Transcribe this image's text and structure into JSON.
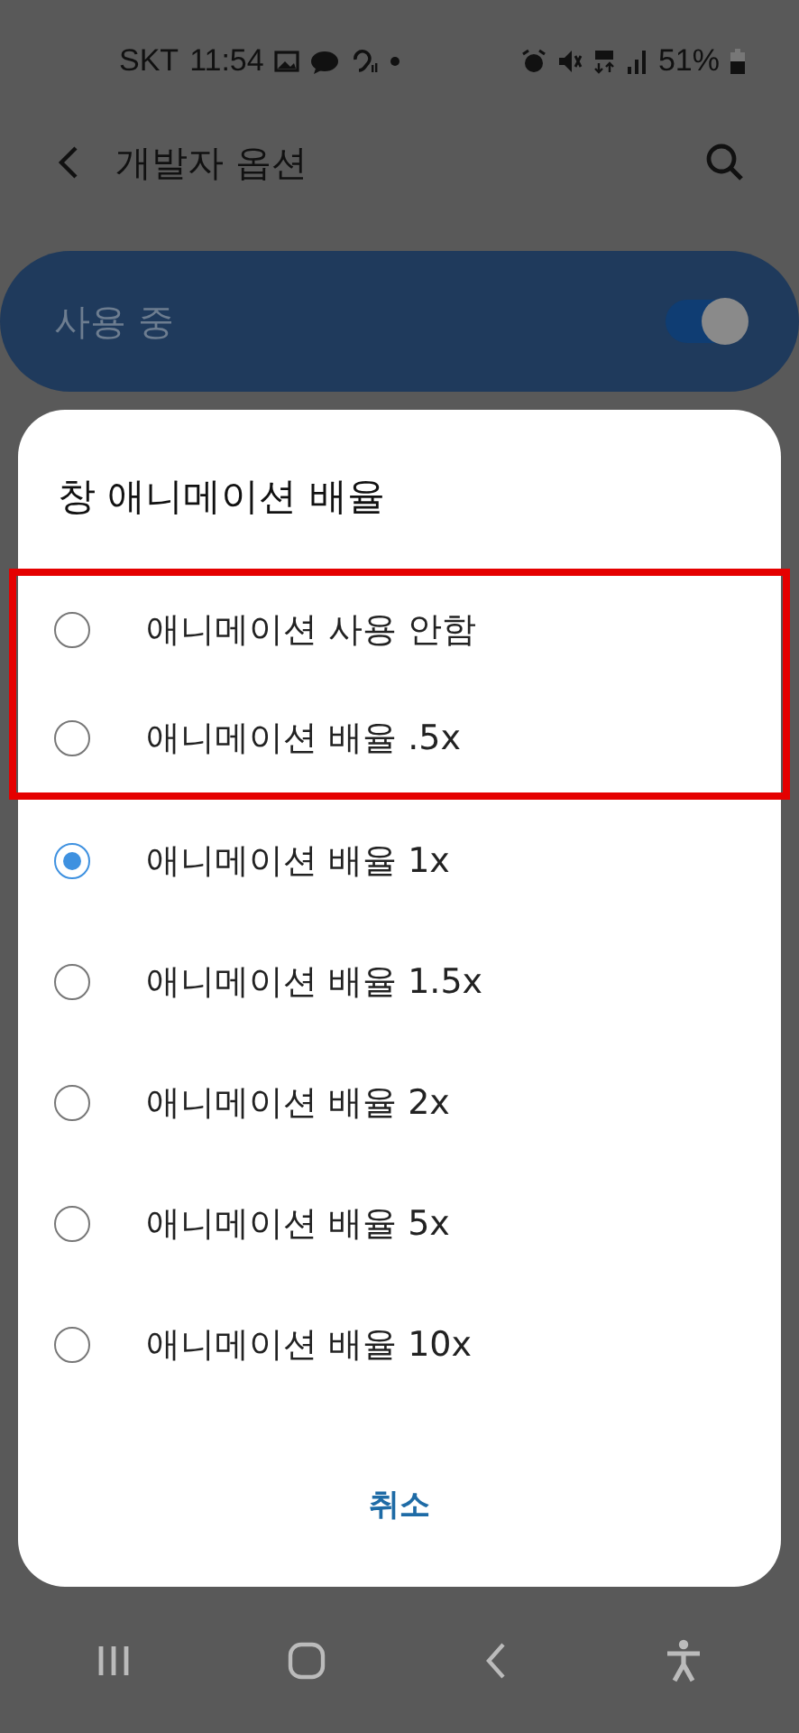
{
  "status_bar": {
    "carrier": "SKT",
    "time": "11:54",
    "battery": "51%"
  },
  "header": {
    "title": "개발자 옵션"
  },
  "master_switch": {
    "label": "사용 중",
    "on": true
  },
  "dialog": {
    "title": "창 애니메이션 배율",
    "options": [
      {
        "label": "애니메이션 사용 안함",
        "selected": false,
        "highlighted": true
      },
      {
        "label": "애니메이션 배율 .5x",
        "selected": false,
        "highlighted": true
      },
      {
        "label": "애니메이션 배율 1x",
        "selected": true,
        "highlighted": false
      },
      {
        "label": "애니메이션 배율 1.5x",
        "selected": false,
        "highlighted": false
      },
      {
        "label": "애니메이션 배율 2x",
        "selected": false,
        "highlighted": false
      },
      {
        "label": "애니메이션 배율 5x",
        "selected": false,
        "highlighted": false
      },
      {
        "label": "애니메이션 배율 10x",
        "selected": false,
        "highlighted": false
      }
    ],
    "cancel": "취소"
  }
}
